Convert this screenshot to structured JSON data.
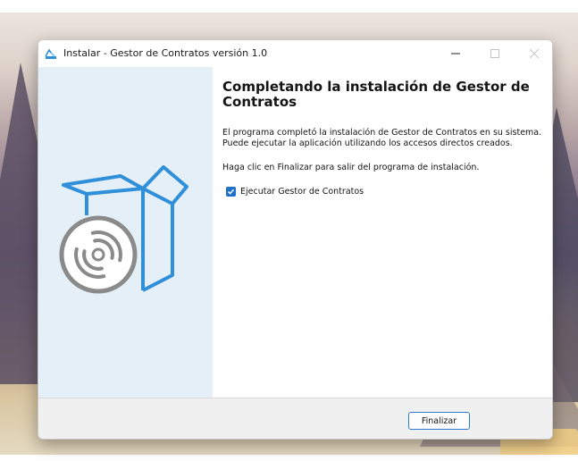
{
  "window": {
    "title": "Instalar - Gestor de Contratos versión 1.0",
    "controls": {
      "minimize_icon": "minimize-icon",
      "maximize_icon": "maximize-icon",
      "close_icon": "close-icon"
    }
  },
  "content": {
    "heading": "Completando la instalación de Gestor de Contratos",
    "paragraph1": "El programa completó la instalación de Gestor de Contratos en su sistema. Puede ejecutar la aplicación utilizando los accesos directos creados.",
    "paragraph2": "Haga clic en Finalizar para salir del programa de instalación.",
    "checkbox": {
      "label": "Ejecutar Gestor de Contratos",
      "checked": true
    }
  },
  "footer": {
    "finish_label": "Finalizar"
  },
  "colors": {
    "accent": "#1e70c9",
    "side_panel": "#e4eff8",
    "art_blue": "#2f8fd8",
    "art_gray": "#8a8a8a"
  },
  "icons": {
    "app": "installer-app-icon",
    "art": "software-box-with-disc-icon"
  }
}
